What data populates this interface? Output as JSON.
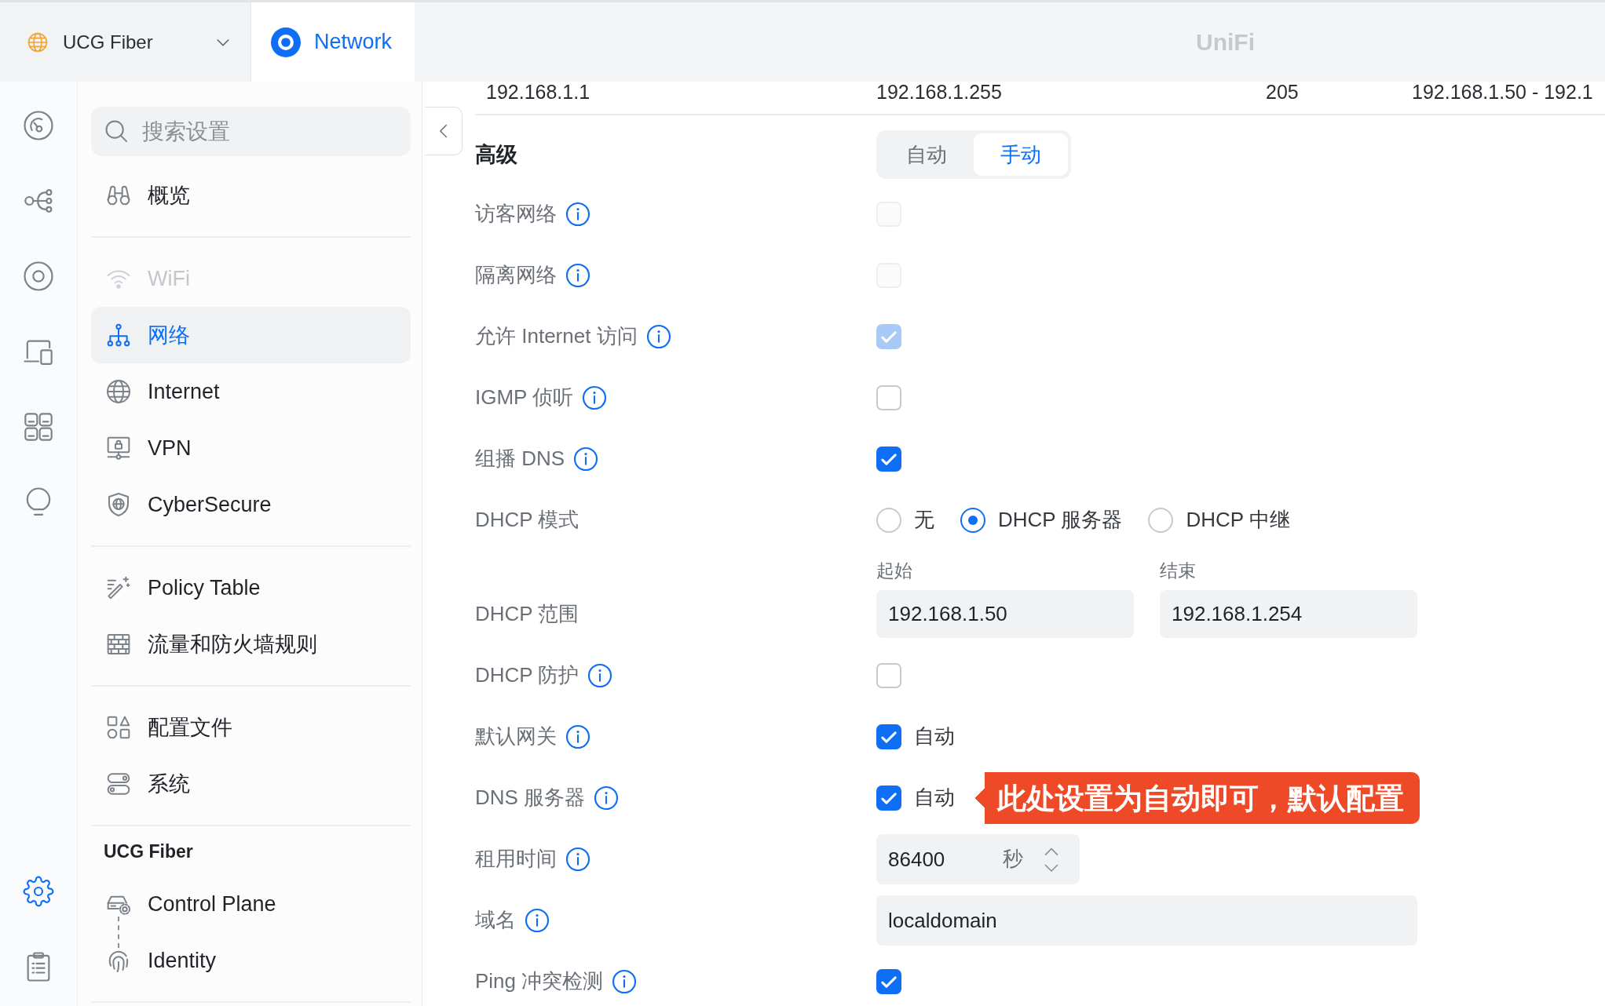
{
  "top_bar": {
    "site": {
      "label": "UCG Fiber"
    },
    "apps": [
      {
        "label": "Network",
        "selected": true
      }
    ],
    "brand": "UniFi"
  },
  "rail": {
    "top": [
      {
        "kind": "gauge",
        "selected": false
      },
      {
        "kind": "topology",
        "selected": false
      },
      {
        "kind": "ring",
        "selected": false
      },
      {
        "kind": "devices",
        "selected": false
      },
      {
        "kind": "grid",
        "selected": false
      },
      {
        "kind": "lightbulb",
        "selected": false
      }
    ],
    "bottom": [
      {
        "kind": "settings",
        "selected": true
      },
      {
        "kind": "clipboard",
        "selected": false
      }
    ]
  },
  "sidebar": {
    "search": {
      "placeholder": "搜索设置"
    },
    "groups": [
      {
        "items": [
          {
            "label": "概览",
            "kind": "binoculars",
            "selected": false,
            "disabled": false
          }
        ]
      },
      {
        "items": [
          {
            "label": "WiFi",
            "kind": "wifi",
            "selected": false,
            "disabled": true
          },
          {
            "label": "网络",
            "kind": "hierarchy",
            "selected": true,
            "disabled": false
          },
          {
            "label": "Internet",
            "kind": "globe",
            "selected": false,
            "disabled": false
          },
          {
            "label": "VPN",
            "kind": "monitor-lock",
            "selected": false,
            "disabled": false
          },
          {
            "label": "CyberSecure",
            "kind": "shield",
            "selected": false,
            "disabled": false
          }
        ]
      },
      {
        "items": [
          {
            "label": "Policy Table",
            "kind": "wand",
            "selected": false,
            "disabled": false
          },
          {
            "label": "流量和防火墙规则",
            "kind": "wall",
            "selected": false,
            "disabled": false
          }
        ]
      },
      {
        "items": [
          {
            "label": "配置文件",
            "kind": "shapes",
            "selected": false,
            "disabled": false
          },
          {
            "label": "系统",
            "kind": "toggles",
            "selected": false,
            "disabled": false
          }
        ]
      },
      {
        "title": "UCG Fiber",
        "connected": true,
        "items": [
          {
            "label": "Control Plane",
            "kind": "server",
            "selected": false,
            "disabled": false
          },
          {
            "label": "Identity",
            "kind": "fingerprint",
            "selected": false,
            "disabled": false
          }
        ]
      }
    ]
  },
  "table_row": {
    "cells": [
      "192.168.1.1",
      "192.168.1.255",
      "205",
      "192.168.1.50 - 192.1"
    ]
  },
  "form": {
    "title": "高级",
    "mode": [
      {
        "label": "自动",
        "selected": false
      },
      {
        "label": "手动",
        "selected": true
      }
    ],
    "rows": [
      {
        "kind": "checkbox",
        "label": "访客网络",
        "info": true,
        "checked": false,
        "disabled": true
      },
      {
        "kind": "checkbox",
        "label": "隔离网络",
        "info": true,
        "checked": false,
        "disabled": true
      },
      {
        "kind": "checkbox",
        "label": "允许 Internet 访问",
        "info": true,
        "checked": true,
        "disabled": true
      },
      {
        "kind": "checkbox",
        "label": "IGMP 侦听",
        "info": true,
        "checked": false,
        "disabled": false
      },
      {
        "kind": "checkbox",
        "label": "组播 DNS",
        "info": true,
        "checked": true,
        "disabled": false
      },
      {
        "kind": "radio",
        "label": "DHCP 模式",
        "info": false,
        "options": [
          {
            "label": "无",
            "selected": false
          },
          {
            "label": "DHCP 服务器",
            "selected": true
          },
          {
            "label": "DHCP 中继",
            "selected": false
          }
        ]
      },
      {
        "kind": "range",
        "label": "DHCP 范围",
        "info": false,
        "start": {
          "caption": "起始",
          "value": "192.168.1.50"
        },
        "end": {
          "caption": "结束",
          "value": "192.168.1.254"
        }
      },
      {
        "kind": "checkbox",
        "label": "DHCP 防护",
        "info": true,
        "checked": false,
        "disabled": false
      },
      {
        "kind": "checkbox",
        "label": "默认网关",
        "info": true,
        "checked": true,
        "disabled": false,
        "text": "自动"
      },
      {
        "kind": "checkbox",
        "label": "DNS 服务器",
        "info": true,
        "checked": true,
        "disabled": false,
        "text": "自动",
        "callout": "此处设置为自动即可，默认配置"
      },
      {
        "kind": "number",
        "label": "租用时间",
        "info": true,
        "value": "86400",
        "unit": "秒"
      },
      {
        "kind": "text",
        "label": "域名",
        "info": true,
        "value": "localdomain"
      },
      {
        "kind": "checkbox",
        "label": "Ping 冲突检测",
        "info": true,
        "checked": true,
        "disabled": false
      }
    ]
  }
}
